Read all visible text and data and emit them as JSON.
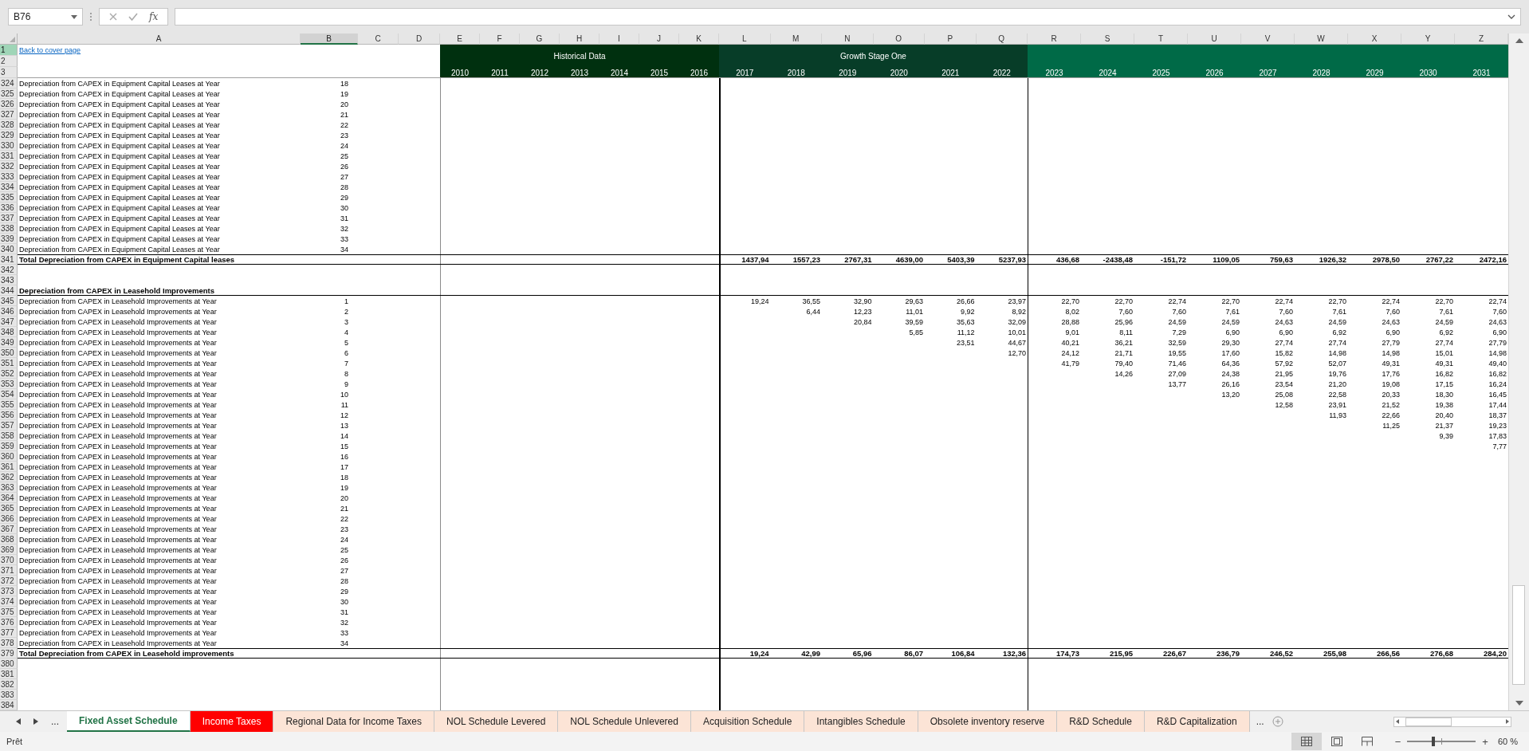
{
  "formula_bar": {
    "name_box": "B76",
    "function_label": "fx"
  },
  "columns": [
    {
      "label": "A",
      "selected": false
    },
    {
      "label": "B",
      "selected": true
    },
    {
      "label": "C",
      "selected": false
    },
    {
      "label": "D",
      "selected": false
    },
    {
      "label": "E",
      "selected": false
    },
    {
      "label": "F",
      "selected": false
    },
    {
      "label": "G",
      "selected": false
    },
    {
      "label": "H",
      "selected": false
    },
    {
      "label": "I",
      "selected": false
    },
    {
      "label": "J",
      "selected": false
    },
    {
      "label": "K",
      "selected": false
    },
    {
      "label": "L",
      "selected": false
    },
    {
      "label": "M",
      "selected": false
    },
    {
      "label": "N",
      "selected": false
    },
    {
      "label": "O",
      "selected": false
    },
    {
      "label": "P",
      "selected": false
    },
    {
      "label": "Q",
      "selected": false
    },
    {
      "label": "R",
      "selected": false
    },
    {
      "label": "S",
      "selected": false
    },
    {
      "label": "T",
      "selected": false
    },
    {
      "label": "U",
      "selected": false
    },
    {
      "label": "V",
      "selected": false
    },
    {
      "label": "W",
      "selected": false
    },
    {
      "label": "X",
      "selected": false
    },
    {
      "label": "Y",
      "selected": false
    },
    {
      "label": "Z",
      "selected": false
    }
  ],
  "top_rows": [
    {
      "number": "1",
      "selected": true
    },
    {
      "number": "2",
      "selected": false
    },
    {
      "number": "3",
      "selected": false
    }
  ],
  "link": "Back to cover page",
  "bands": [
    {
      "title": "Historical Data",
      "color": "#00300f",
      "years": [
        "2010",
        "2011",
        "2012",
        "2013",
        "2014",
        "2015",
        "2016"
      ]
    },
    {
      "title": "Growth Stage One",
      "color": "#073d28",
      "years": [
        "2017",
        "2018",
        "2019",
        "2020",
        "2021",
        "2022"
      ]
    },
    {
      "color": "#006a47",
      "years": [
        "2023",
        "2024",
        "2025",
        "2026",
        "2027",
        "2028",
        "2029",
        "2030",
        "2031"
      ]
    }
  ],
  "rows": [
    {
      "number": "324",
      "selected": false,
      "kind": "item",
      "label": "Depreciation from CAPEX in Equipment Capital Leases at Year",
      "year": "18"
    },
    {
      "number": "325",
      "selected": false,
      "kind": "item",
      "label": "Depreciation from CAPEX in Equipment Capital Leases at Year",
      "year": "19"
    },
    {
      "number": "326",
      "selected": false,
      "kind": "item",
      "label": "Depreciation from CAPEX in Equipment Capital Leases at Year",
      "year": "20"
    },
    {
      "number": "327",
      "selected": false,
      "kind": "item",
      "label": "Depreciation from CAPEX in Equipment Capital Leases at Year",
      "year": "21"
    },
    {
      "number": "328",
      "selected": false,
      "kind": "item",
      "label": "Depreciation from CAPEX in Equipment Capital Leases at Year",
      "year": "22"
    },
    {
      "number": "329",
      "selected": false,
      "kind": "item",
      "label": "Depreciation from CAPEX in Equipment Capital Leases at Year",
      "year": "23"
    },
    {
      "number": "330",
      "selected": false,
      "kind": "item",
      "label": "Depreciation from CAPEX in Equipment Capital Leases at Year",
      "year": "24"
    },
    {
      "number": "331",
      "selected": false,
      "kind": "item",
      "label": "Depreciation from CAPEX in Equipment Capital Leases at Year",
      "year": "25"
    },
    {
      "number": "332",
      "selected": false,
      "kind": "item",
      "label": "Depreciation from CAPEX in Equipment Capital Leases at Year",
      "year": "26"
    },
    {
      "number": "333",
      "selected": false,
      "kind": "item",
      "label": "Depreciation from CAPEX in Equipment Capital Leases at Year",
      "year": "27"
    },
    {
      "number": "334",
      "selected": false,
      "kind": "item",
      "label": "Depreciation from CAPEX in Equipment Capital Leases at Year",
      "year": "28"
    },
    {
      "number": "335",
      "selected": false,
      "kind": "item",
      "label": "Depreciation from CAPEX in Equipment Capital Leases at Year",
      "year": "29"
    },
    {
      "number": "336",
      "selected": false,
      "kind": "item",
      "label": "Depreciation from CAPEX in Equipment Capital Leases at Year",
      "year": "30"
    },
    {
      "number": "337",
      "selected": false,
      "kind": "item",
      "label": "Depreciation from CAPEX in Equipment Capital Leases at Year",
      "year": "31"
    },
    {
      "number": "338",
      "selected": false,
      "kind": "item",
      "label": "Depreciation from CAPEX in Equipment Capital Leases at Year",
      "year": "32"
    },
    {
      "number": "339",
      "selected": false,
      "kind": "item",
      "label": "Depreciation from CAPEX in Equipment Capital Leases at Year",
      "year": "33"
    },
    {
      "number": "340",
      "selected": false,
      "kind": "item",
      "label": "Depreciation from CAPEX in Equipment Capital Leases at Year",
      "year": "34"
    },
    {
      "number": "341",
      "selected": false,
      "kind": "total",
      "label": "Total Depreciation from CAPEX in Equipment Capital leases",
      "values": [
        "1437,94",
        "1557,23",
        "2767,31",
        "4639,00",
        "5403,39",
        "5237,93",
        "436,68",
        "-2438,48",
        "-151,72",
        "1109,05",
        "759,63",
        "1926,32",
        "2978,50",
        "2767,22",
        "2472,16"
      ]
    },
    {
      "number": "342",
      "selected": false,
      "kind": "blank"
    },
    {
      "number": "343",
      "selected": false,
      "kind": "blank"
    },
    {
      "number": "344",
      "selected": false,
      "kind": "section",
      "label": "Depreciation from CAPEX in Leasehold Improvements"
    },
    {
      "number": "345",
      "selected": false,
      "kind": "item",
      "label": "Depreciation from CAPEX in Leasehold Improvements at Year",
      "year": "1",
      "values": [
        "19,24",
        "36,55",
        "32,90",
        "29,63",
        "26,66",
        "23,97",
        "22,70",
        "22,70",
        "22,74",
        "22,70",
        "22,74",
        "22,70",
        "22,74",
        "22,70",
        "22,74"
      ]
    },
    {
      "number": "346",
      "selected": false,
      "kind": "item",
      "label": "Depreciation from CAPEX in Leasehold Improvements at Year",
      "year": "2",
      "values": [
        "6,44",
        "12,23",
        "11,01",
        "9,92",
        "8,92",
        "8,02",
        "7,60",
        "7,60",
        "7,61",
        "7,60",
        "7,61",
        "7,60",
        "7,61",
        "7,60"
      ]
    },
    {
      "number": "347",
      "selected": false,
      "kind": "item",
      "label": "Depreciation from CAPEX in Leasehold Improvements at Year",
      "year": "3",
      "values": [
        "20,84",
        "39,59",
        "35,63",
        "32,09",
        "28,88",
        "25,96",
        "24,59",
        "24,59",
        "24,63",
        "24,59",
        "24,63",
        "24,59",
        "24,63"
      ]
    },
    {
      "number": "348",
      "selected": false,
      "kind": "item",
      "label": "Depreciation from CAPEX in Leasehold Improvements at Year",
      "year": "4",
      "values": [
        "5,85",
        "11,12",
        "10,01",
        "9,01",
        "8,11",
        "7,29",
        "6,90",
        "6,90",
        "6,92",
        "6,90",
        "6,92",
        "6,90"
      ]
    },
    {
      "number": "349",
      "selected": false,
      "kind": "item",
      "label": "Depreciation from CAPEX in Leasehold Improvements at Year",
      "year": "5",
      "values": [
        "23,51",
        "44,67",
        "40,21",
        "36,21",
        "32,59",
        "29,30",
        "27,74",
        "27,74",
        "27,79",
        "27,74",
        "27,79"
      ]
    },
    {
      "number": "350",
      "selected": false,
      "kind": "item",
      "label": "Depreciation from CAPEX in Leasehold Improvements at Year",
      "year": "6",
      "values": [
        "12,70",
        "24,12",
        "21,71",
        "19,55",
        "17,60",
        "15,82",
        "14,98",
        "14,98",
        "15,01",
        "14,98"
      ]
    },
    {
      "number": "351",
      "selected": false,
      "kind": "item",
      "label": "Depreciation from CAPEX in Leasehold Improvements at Year",
      "year": "7",
      "values": [
        "41,79",
        "79,40",
        "71,46",
        "64,36",
        "57,92",
        "52,07",
        "49,31",
        "49,31",
        "49,40"
      ]
    },
    {
      "number": "352",
      "selected": false,
      "kind": "item",
      "label": "Depreciation from CAPEX in Leasehold Improvements at Year",
      "year": "8",
      "values": [
        "14,26",
        "27,09",
        "24,38",
        "21,95",
        "19,76",
        "17,76",
        "16,82",
        "16,82"
      ]
    },
    {
      "number": "353",
      "selected": false,
      "kind": "item",
      "label": "Depreciation from CAPEX in Leasehold Improvements at Year",
      "year": "9",
      "values": [
        "13,77",
        "26,16",
        "23,54",
        "21,20",
        "19,08",
        "17,15",
        "16,24"
      ]
    },
    {
      "number": "354",
      "selected": false,
      "kind": "item",
      "label": "Depreciation from CAPEX in Leasehold Improvements at Year",
      "year": "10",
      "values": [
        "13,20",
        "25,08",
        "22,58",
        "20,33",
        "18,30",
        "16,45"
      ]
    },
    {
      "number": "355",
      "selected": false,
      "kind": "item",
      "label": "Depreciation from CAPEX in Leasehold Improvements at Year",
      "year": "11",
      "values": [
        "12,58",
        "23,91",
        "21,52",
        "19,38",
        "17,44"
      ]
    },
    {
      "number": "356",
      "selected": false,
      "kind": "item",
      "label": "Depreciation from CAPEX in Leasehold Improvements at Year",
      "year": "12",
      "values": [
        "11,93",
        "22,66",
        "20,40",
        "18,37"
      ]
    },
    {
      "number": "357",
      "selected": false,
      "kind": "item",
      "label": "Depreciation from CAPEX in Leasehold Improvements at Year",
      "year": "13",
      "values": [
        "11,25",
        "21,37",
        "19,23"
      ]
    },
    {
      "number": "358",
      "selected": false,
      "kind": "item",
      "label": "Depreciation from CAPEX in Leasehold Improvements at Year",
      "year": "14",
      "values": [
        "9,39",
        "17,83"
      ]
    },
    {
      "number": "359",
      "selected": false,
      "kind": "item",
      "label": "Depreciation from CAPEX in Leasehold Improvements at Year",
      "year": "15",
      "values": [
        "7,77"
      ]
    },
    {
      "number": "360",
      "selected": false,
      "kind": "item",
      "label": "Depreciation from CAPEX in Leasehold Improvements at Year",
      "year": "16"
    },
    {
      "number": "361",
      "selected": false,
      "kind": "item",
      "label": "Depreciation from CAPEX in Leasehold Improvements at Year",
      "year": "17"
    },
    {
      "number": "362",
      "selected": false,
      "kind": "item",
      "label": "Depreciation from CAPEX in Leasehold Improvements at Year",
      "year": "18"
    },
    {
      "number": "363",
      "selected": false,
      "kind": "item",
      "label": "Depreciation from CAPEX in Leasehold Improvements at Year",
      "year": "19"
    },
    {
      "number": "364",
      "selected": false,
      "kind": "item",
      "label": "Depreciation from CAPEX in Leasehold Improvements at Year",
      "year": "20"
    },
    {
      "number": "365",
      "selected": false,
      "kind": "item",
      "label": "Depreciation from CAPEX in Leasehold Improvements at Year",
      "year": "21"
    },
    {
      "number": "366",
      "selected": false,
      "kind": "item",
      "label": "Depreciation from CAPEX in Leasehold Improvements at Year",
      "year": "22"
    },
    {
      "number": "367",
      "selected": false,
      "kind": "item",
      "label": "Depreciation from CAPEX in Leasehold Improvements at Year",
      "year": "23"
    },
    {
      "number": "368",
      "selected": false,
      "kind": "item",
      "label": "Depreciation from CAPEX in Leasehold Improvements at Year",
      "year": "24"
    },
    {
      "number": "369",
      "selected": false,
      "kind": "item",
      "label": "Depreciation from CAPEX in Leasehold Improvements at Year",
      "year": "25"
    },
    {
      "number": "370",
      "selected": false,
      "kind": "item",
      "label": "Depreciation from CAPEX in Leasehold Improvements at Year",
      "year": "26"
    },
    {
      "number": "371",
      "selected": false,
      "kind": "item",
      "label": "Depreciation from CAPEX in Leasehold Improvements at Year",
      "year": "27"
    },
    {
      "number": "372",
      "selected": false,
      "kind": "item",
      "label": "Depreciation from CAPEX in Leasehold Improvements at Year",
      "year": "28"
    },
    {
      "number": "373",
      "selected": false,
      "kind": "item",
      "label": "Depreciation from CAPEX in Leasehold Improvements at Year",
      "year": "29"
    },
    {
      "number": "374",
      "selected": false,
      "kind": "item",
      "label": "Depreciation from CAPEX in Leasehold Improvements at Year",
      "year": "30"
    },
    {
      "number": "375",
      "selected": false,
      "kind": "item",
      "label": "Depreciation from CAPEX in Leasehold Improvements at Year",
      "year": "31"
    },
    {
      "number": "376",
      "selected": false,
      "kind": "item",
      "label": "Depreciation from CAPEX in Leasehold Improvements at Year",
      "year": "32"
    },
    {
      "number": "377",
      "selected": false,
      "kind": "item",
      "label": "Depreciation from CAPEX in Leasehold Improvements at Year",
      "year": "33"
    },
    {
      "number": "378",
      "selected": false,
      "kind": "item",
      "label": "Depreciation from CAPEX in Leasehold Improvements at Year",
      "year": "34"
    },
    {
      "number": "379",
      "selected": false,
      "kind": "total",
      "label": "Total Depreciation from CAPEX in Leasehold improvements",
      "values": [
        "19,24",
        "42,99",
        "65,96",
        "86,07",
        "106,84",
        "132,36",
        "174,73",
        "215,95",
        "226,67",
        "236,79",
        "246,52",
        "255,98",
        "266,56",
        "276,68",
        "284,20"
      ]
    },
    {
      "number": "380",
      "selected": false,
      "kind": "blank"
    },
    {
      "number": "381",
      "selected": false,
      "kind": "blank"
    },
    {
      "number": "382",
      "selected": false,
      "kind": "blank"
    },
    {
      "number": "383",
      "selected": false,
      "kind": "blank"
    },
    {
      "number": "384",
      "selected": false,
      "kind": "blank"
    }
  ],
  "tab_bar": {
    "overflow_left": "...",
    "overflow_right": "...",
    "tabs": [
      {
        "label": "Fixed Asset Schedule",
        "selected": true
      },
      {
        "label": "Income Taxes",
        "selected": false,
        "color": "#ff0000"
      },
      {
        "label": "Regional Data for Income Taxes",
        "selected": false,
        "color": "#fce4d6"
      },
      {
        "label": "NOL Schedule Levered",
        "selected": false,
        "color": "#fce4d6"
      },
      {
        "label": "NOL Schedule Unlevered",
        "selected": false,
        "color": "#fce4d6"
      },
      {
        "label": "Acquisition Schedule",
        "selected": false,
        "color": "#fce4d6"
      },
      {
        "label": "Intangibles Schedule",
        "selected": false,
        "color": "#fce4d6"
      },
      {
        "label": "Obsolete inventory reserve",
        "selected": false,
        "color": "#fce4d6"
      },
      {
        "label": "R&D Schedule",
        "selected": false,
        "color": "#fce4d6"
      },
      {
        "label": "R&D Capitalization",
        "selected": false,
        "color": "#fce4d6"
      }
    ]
  },
  "status_bar": {
    "status": "Prêt",
    "zoom_out": "−",
    "zoom_in": "+",
    "zoom_slider": {
      "level": 0.38
    },
    "zoom": "60 %"
  }
}
